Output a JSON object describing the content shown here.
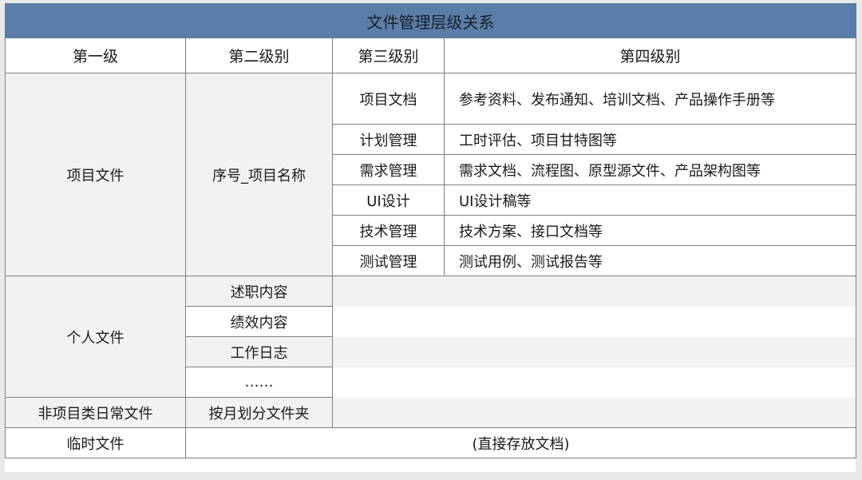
{
  "title": "文件管理层级关系",
  "headers": [
    "第一级",
    "第二级别",
    "第三级别",
    "第四级别"
  ],
  "project": {
    "level1": "项目文件",
    "level2": "序号_项目名称",
    "rows": [
      {
        "level3": "项目文档",
        "level4": "参考资料、发布通知、培训文档、产品操作手册等"
      },
      {
        "level3": "计划管理",
        "level4": "工时评估、项目甘特图等"
      },
      {
        "level3": "需求管理",
        "level4": "需求文档、流程图、原型源文件、产品架构图等"
      },
      {
        "level3": "UI设计",
        "level4": "UI设计稿等"
      },
      {
        "level3": "技术管理",
        "level4": "技术方案、接口文档等"
      },
      {
        "level3": "测试管理",
        "level4": "测试用例、测试报告等"
      }
    ]
  },
  "personal": {
    "level1": "个人文件",
    "items": [
      "述职内容",
      "绩效内容",
      "工作日志",
      "……"
    ]
  },
  "daily": {
    "level1": "非项目类日常文件",
    "level2": "按月划分文件夹"
  },
  "temp": {
    "level1": "临时文件",
    "note": "(直接存放文档)"
  }
}
